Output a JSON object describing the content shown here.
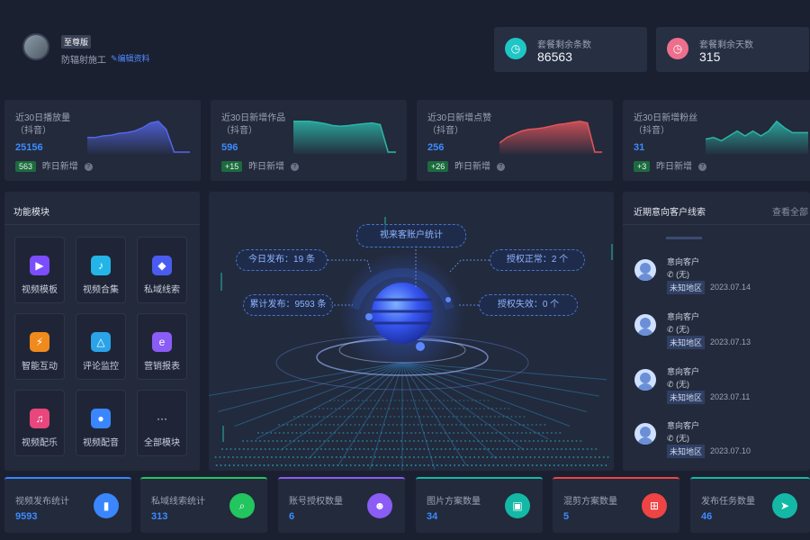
{
  "profile": {
    "vip_badge": "至尊版",
    "name": "防辐射施工",
    "edit_link": "编辑资料"
  },
  "quota": [
    {
      "label": "套餐剩余条数",
      "value": "86563",
      "color": "#1fc6c6"
    },
    {
      "label": "套餐剩余天数",
      "value": "315",
      "color": "#ee6f8d"
    }
  ],
  "stats": [
    {
      "title": "近30日播放量（抖音）",
      "value": "25156",
      "delta": "563",
      "delta_label": "昨日新增",
      "color": "#5466e8",
      "trend": [
        0.55,
        0.55,
        0.5,
        0.48,
        0.42,
        0.4,
        0.35,
        0.25,
        0.1,
        0.05,
        0.3,
        1.0,
        1.0,
        1.0
      ]
    },
    {
      "title": "近30日新增作品（抖音）",
      "value": "596",
      "delta": "+15",
      "delta_label": "昨日新增",
      "color": "#2bb6a8",
      "trend": [
        0.05,
        0.05,
        0.05,
        0.08,
        0.12,
        0.18,
        0.2,
        0.18,
        0.15,
        0.12,
        0.1,
        0.15,
        1.0,
        1.0
      ]
    },
    {
      "title": "近30日新增点赞（抖音）",
      "value": "256",
      "delta": "+26",
      "delta_label": "昨日新增",
      "color": "#e2555c",
      "trend": [
        0.72,
        0.55,
        0.45,
        0.35,
        0.3,
        0.28,
        0.25,
        0.2,
        0.15,
        0.12,
        0.08,
        0.05,
        0.1,
        1.0,
        1.0
      ]
    },
    {
      "title": "近30日新增粉丝（抖音）",
      "value": "31",
      "delta": "+3",
      "delta_label": "昨日新增",
      "color": "#2bb6a8",
      "trend": [
        0.6,
        0.55,
        0.65,
        0.5,
        0.35,
        0.5,
        0.35,
        0.5,
        0.35,
        0.05,
        0.25,
        0.4,
        0.4,
        0.4
      ]
    }
  ],
  "modules": {
    "title": "功能模块",
    "items": [
      {
        "label": "视频模板",
        "icon": "video-template-icon",
        "glyph": "▶",
        "color": "#7b4dff"
      },
      {
        "label": "视频合集",
        "icon": "video-collection-icon",
        "glyph": "♪",
        "color": "#23b5e8"
      },
      {
        "label": "私域线索",
        "icon": "private-leads-icon",
        "glyph": "◆",
        "color": "#4a5cf0"
      },
      {
        "label": "智能互动",
        "icon": "smart-interaction-icon",
        "glyph": "⚡",
        "color": "#f08a1c"
      },
      {
        "label": "评论监控",
        "icon": "comment-monitor-icon",
        "glyph": "△",
        "color": "#2aa3e8"
      },
      {
        "label": "营销报表",
        "icon": "marketing-report-icon",
        "glyph": "e",
        "color": "#8b5cf6"
      },
      {
        "label": "视频配乐",
        "icon": "video-music-icon",
        "glyph": "♫",
        "color": "#e8467c"
      },
      {
        "label": "视频配音",
        "icon": "video-dubbing-icon",
        "glyph": "●",
        "color": "#3a86ff"
      },
      {
        "label": "全部模块",
        "icon": "more-icon",
        "glyph": "···",
        "color": "transparent"
      }
    ]
  },
  "center": {
    "title": "视来客账户统计",
    "today_publish": "今日发布：19 条",
    "total_publish": "累计发布：9593 条",
    "auth_ok": "授权正常：2 个",
    "auth_fail": "授权失效：0 个"
  },
  "leads": {
    "title": "近期意向客户线索",
    "view_all": "查看全部",
    "items": [
      {
        "name": "意向客户",
        "phone": "(无)",
        "region": "未知地区",
        "date": "2023.07.14"
      },
      {
        "name": "意向客户",
        "phone": "(无)",
        "region": "未知地区",
        "date": "2023.07.13"
      },
      {
        "name": "意向客户",
        "phone": "(无)",
        "region": "未知地区",
        "date": "2023.07.11"
      },
      {
        "name": "意向客户",
        "phone": "(无)",
        "region": "未知地区",
        "date": "2023.07.10"
      }
    ]
  },
  "bottom": [
    {
      "title": "视频发布统计",
      "value": "9593",
      "color": "#3a86ff",
      "glyph": "▮",
      "icon": "video-camera-icon",
      "accent": "#3a86ff"
    },
    {
      "title": "私域线索统计",
      "value": "313",
      "color": "#22c55e",
      "glyph": "⌕",
      "icon": "search-icon",
      "accent": "#22c55e"
    },
    {
      "title": "账号授权数量",
      "value": "6",
      "color": "#8b5cf6",
      "glyph": "☻",
      "icon": "user-group-icon",
      "accent": "#8b5cf6"
    },
    {
      "title": "图片方案数量",
      "value": "34",
      "color": "#14b8a6",
      "glyph": "▣",
      "icon": "image-icon",
      "accent": "#14b8a6"
    },
    {
      "title": "混剪方案数量",
      "value": "5",
      "color": "#ef4444",
      "glyph": "⊞",
      "icon": "grid-icon",
      "accent": "#ef4444"
    },
    {
      "title": "发布任务数量",
      "value": "46",
      "color": "#14b8a6",
      "glyph": "➤",
      "icon": "send-icon",
      "accent": "#14b8a6"
    }
  ]
}
